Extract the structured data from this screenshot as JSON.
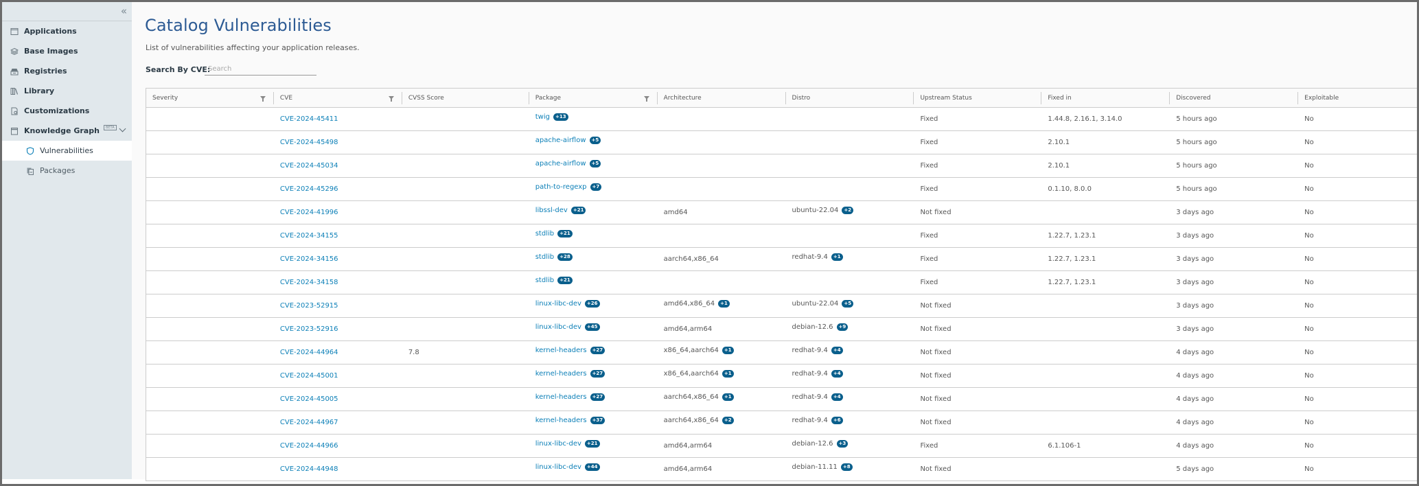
{
  "sidebar": {
    "collapse_label": "«",
    "items": [
      {
        "label": "Applications",
        "icon": "window-icon"
      },
      {
        "label": "Base Images",
        "icon": "layers-icon"
      },
      {
        "label": "Registries",
        "icon": "archive-icon"
      },
      {
        "label": "Library",
        "icon": "books-icon"
      },
      {
        "label": "Customizations",
        "icon": "file-gear-icon"
      },
      {
        "label": "Knowledge Graph",
        "icon": "window-icon",
        "badge": "BETA",
        "expanded": true
      }
    ],
    "sub_items": [
      {
        "label": "Vulnerabilities",
        "icon": "shield-icon",
        "active": true
      },
      {
        "label": "Packages",
        "icon": "copy-icon",
        "active": false
      }
    ]
  },
  "page": {
    "title": "Catalog Vulnerabilities",
    "subtitle": "List of vulnerabilities affecting your application releases.",
    "search_label": "Search By CVE:",
    "search_placeholder": "Search",
    "search_value": ""
  },
  "colors": {
    "title": "#2d5b94",
    "link": "#0b7fb7",
    "badge": "#0a5f8c",
    "sidebar_bg": "#e1e8ec"
  },
  "table": {
    "columns": [
      {
        "label": "Severity",
        "filter": true
      },
      {
        "label": "CVE",
        "filter": true
      },
      {
        "label": "CVSS Score",
        "filter": false
      },
      {
        "label": "Package",
        "filter": true
      },
      {
        "label": "Architecture",
        "filter": false
      },
      {
        "label": "Distro",
        "filter": false
      },
      {
        "label": "Upstream Status",
        "filter": false
      },
      {
        "label": "Fixed in",
        "filter": false
      },
      {
        "label": "Discovered",
        "filter": false
      },
      {
        "label": "Exploitable",
        "filter": false
      }
    ],
    "rows": [
      {
        "severity": "",
        "cve": "CVE-2024-45411",
        "cvss": "",
        "package": "twig",
        "package_more": "+13",
        "arch": "",
        "arch_more": "",
        "distro": "",
        "distro_more": "",
        "status": "Fixed",
        "fixed_in": "1.44.8, 2.16.1, 3.14.0",
        "discovered": "5 hours ago",
        "exploitable": "No"
      },
      {
        "severity": "",
        "cve": "CVE-2024-45498",
        "cvss": "",
        "package": "apache-airflow",
        "package_more": "+5",
        "arch": "",
        "arch_more": "",
        "distro": "",
        "distro_more": "",
        "status": "Fixed",
        "fixed_in": "2.10.1",
        "discovered": "5 hours ago",
        "exploitable": "No"
      },
      {
        "severity": "",
        "cve": "CVE-2024-45034",
        "cvss": "",
        "package": "apache-airflow",
        "package_more": "+5",
        "arch": "",
        "arch_more": "",
        "distro": "",
        "distro_more": "",
        "status": "Fixed",
        "fixed_in": "2.10.1",
        "discovered": "5 hours ago",
        "exploitable": "No"
      },
      {
        "severity": "",
        "cve": "CVE-2024-45296",
        "cvss": "",
        "package": "path-to-regexp",
        "package_more": "+7",
        "arch": "",
        "arch_more": "",
        "distro": "",
        "distro_more": "",
        "status": "Fixed",
        "fixed_in": "0.1.10, 8.0.0",
        "discovered": "5 hours ago",
        "exploitable": "No"
      },
      {
        "severity": "",
        "cve": "CVE-2024-41996",
        "cvss": "",
        "package": "libssl-dev",
        "package_more": "+21",
        "arch": "amd64",
        "arch_more": "",
        "distro": "ubuntu-22.04",
        "distro_more": "+2",
        "status": "Not fixed",
        "fixed_in": "",
        "discovered": "3 days ago",
        "exploitable": "No"
      },
      {
        "severity": "",
        "cve": "CVE-2024-34155",
        "cvss": "",
        "package": "stdlib",
        "package_more": "+21",
        "arch": "",
        "arch_more": "",
        "distro": "",
        "distro_more": "",
        "status": "Fixed",
        "fixed_in": "1.22.7, 1.23.1",
        "discovered": "3 days ago",
        "exploitable": "No"
      },
      {
        "severity": "",
        "cve": "CVE-2024-34156",
        "cvss": "",
        "package": "stdlib",
        "package_more": "+28",
        "arch": "aarch64,x86_64",
        "arch_more": "",
        "distro": "redhat-9.4",
        "distro_more": "+1",
        "status": "Fixed",
        "fixed_in": "1.22.7, 1.23.1",
        "discovered": "3 days ago",
        "exploitable": "No"
      },
      {
        "severity": "",
        "cve": "CVE-2024-34158",
        "cvss": "",
        "package": "stdlib",
        "package_more": "+21",
        "arch": "",
        "arch_more": "",
        "distro": "",
        "distro_more": "",
        "status": "Fixed",
        "fixed_in": "1.22.7, 1.23.1",
        "discovered": "3 days ago",
        "exploitable": "No"
      },
      {
        "severity": "",
        "cve": "CVE-2023-52915",
        "cvss": "",
        "package": "linux-libc-dev",
        "package_more": "+26",
        "arch": "amd64,x86_64",
        "arch_more": "+1",
        "distro": "ubuntu-22.04",
        "distro_more": "+5",
        "status": "Not fixed",
        "fixed_in": "",
        "discovered": "3 days ago",
        "exploitable": "No"
      },
      {
        "severity": "",
        "cve": "CVE-2023-52916",
        "cvss": "",
        "package": "linux-libc-dev",
        "package_more": "+45",
        "arch": "amd64,arm64",
        "arch_more": "",
        "distro": "debian-12.6",
        "distro_more": "+9",
        "status": "Not fixed",
        "fixed_in": "",
        "discovered": "3 days ago",
        "exploitable": "No"
      },
      {
        "severity": "",
        "cve": "CVE-2024-44964",
        "cvss": "7.8",
        "package": "kernel-headers",
        "package_more": "+27",
        "arch": "x86_64,aarch64",
        "arch_more": "+1",
        "distro": "redhat-9.4",
        "distro_more": "+4",
        "status": "Not fixed",
        "fixed_in": "",
        "discovered": "4 days ago",
        "exploitable": "No"
      },
      {
        "severity": "",
        "cve": "CVE-2024-45001",
        "cvss": "",
        "package": "kernel-headers",
        "package_more": "+27",
        "arch": "x86_64,aarch64",
        "arch_more": "+1",
        "distro": "redhat-9.4",
        "distro_more": "+4",
        "status": "Not fixed",
        "fixed_in": "",
        "discovered": "4 days ago",
        "exploitable": "No"
      },
      {
        "severity": "",
        "cve": "CVE-2024-45005",
        "cvss": "",
        "package": "kernel-headers",
        "package_more": "+27",
        "arch": "aarch64,x86_64",
        "arch_more": "+1",
        "distro": "redhat-9.4",
        "distro_more": "+4",
        "status": "Not fixed",
        "fixed_in": "",
        "discovered": "4 days ago",
        "exploitable": "No"
      },
      {
        "severity": "",
        "cve": "CVE-2024-44967",
        "cvss": "",
        "package": "kernel-headers",
        "package_more": "+37",
        "arch": "aarch64,x86_64",
        "arch_more": "+2",
        "distro": "redhat-9.4",
        "distro_more": "+6",
        "status": "Not fixed",
        "fixed_in": "",
        "discovered": "4 days ago",
        "exploitable": "No"
      },
      {
        "severity": "",
        "cve": "CVE-2024-44966",
        "cvss": "",
        "package": "linux-libc-dev",
        "package_more": "+21",
        "arch": "amd64,arm64",
        "arch_more": "",
        "distro": "debian-12.6",
        "distro_more": "+3",
        "status": "Fixed",
        "fixed_in": "6.1.106-1",
        "discovered": "4 days ago",
        "exploitable": "No"
      },
      {
        "severity": "",
        "cve": "CVE-2024-44948",
        "cvss": "",
        "package": "linux-libc-dev",
        "package_more": "+44",
        "arch": "amd64,arm64",
        "arch_more": "",
        "distro": "debian-11.11",
        "distro_more": "+8",
        "status": "Not fixed",
        "fixed_in": "",
        "discovered": "5 days ago",
        "exploitable": "No"
      }
    ]
  }
}
